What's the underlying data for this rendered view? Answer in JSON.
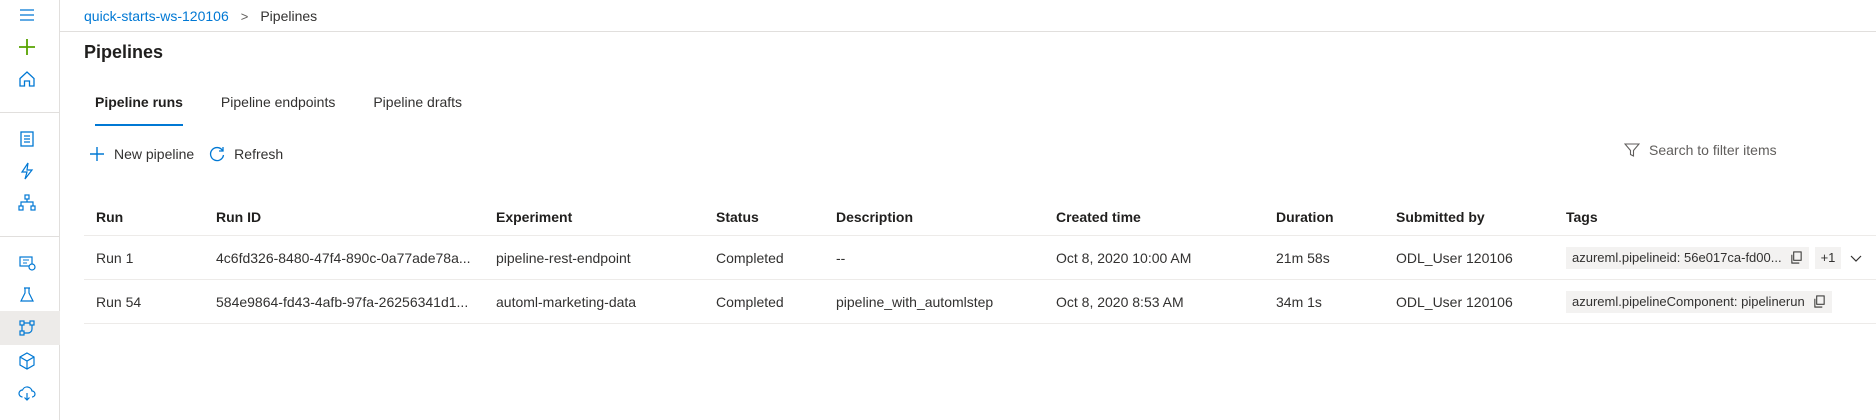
{
  "breadcrumb": {
    "workspace": "quick-starts-ws-120106",
    "separator": ">",
    "current": "Pipelines"
  },
  "page_title": "Pipelines",
  "tabs": [
    {
      "label": "Pipeline runs",
      "active": true
    },
    {
      "label": "Pipeline endpoints",
      "active": false
    },
    {
      "label": "Pipeline drafts",
      "active": false
    }
  ],
  "toolbar": {
    "new_pipeline": "New pipeline",
    "refresh": "Refresh"
  },
  "search": {
    "placeholder": "Search to filter items"
  },
  "table": {
    "columns": [
      "Run",
      "Run ID",
      "Experiment",
      "Status",
      "Description",
      "Created time",
      "Duration",
      "Submitted by",
      "Tags"
    ],
    "rows": [
      {
        "run": "Run 1",
        "run_id": "4c6fd326-8480-47f4-890c-0a77ade78a...",
        "experiment": "pipeline-rest-endpoint",
        "status": "Completed",
        "description": "--",
        "created": "Oct 8, 2020 10:00 AM",
        "duration": "21m 58s",
        "submitted_by": "ODL_User 120106",
        "tag": "azureml.pipelineid: 56e017ca-fd00...",
        "more_tags": "+1"
      },
      {
        "run": "Run 54",
        "run_id": "584e9864-fd43-4afb-97fa-26256341d1...",
        "experiment": "automl-marketing-data",
        "status": "Completed",
        "description": "pipeline_with_automlstep",
        "created": "Oct 8, 2020 8:53 AM",
        "duration": "34m 1s",
        "submitted_by": "ODL_User 120106",
        "tag": "azureml.pipelineComponent: pipelinerun"
      }
    ]
  },
  "rail": {
    "icons": [
      "menu-icon",
      "plus-icon",
      "home-icon",
      "notebook-icon",
      "automl-icon",
      "designer-icon",
      "datasets-icon",
      "experiments-icon",
      "pipelines-icon",
      "models-icon",
      "endpoints-icon"
    ]
  },
  "colors": {
    "accent": "#0078d4",
    "new_green": "#57a300",
    "text": "#323130"
  }
}
